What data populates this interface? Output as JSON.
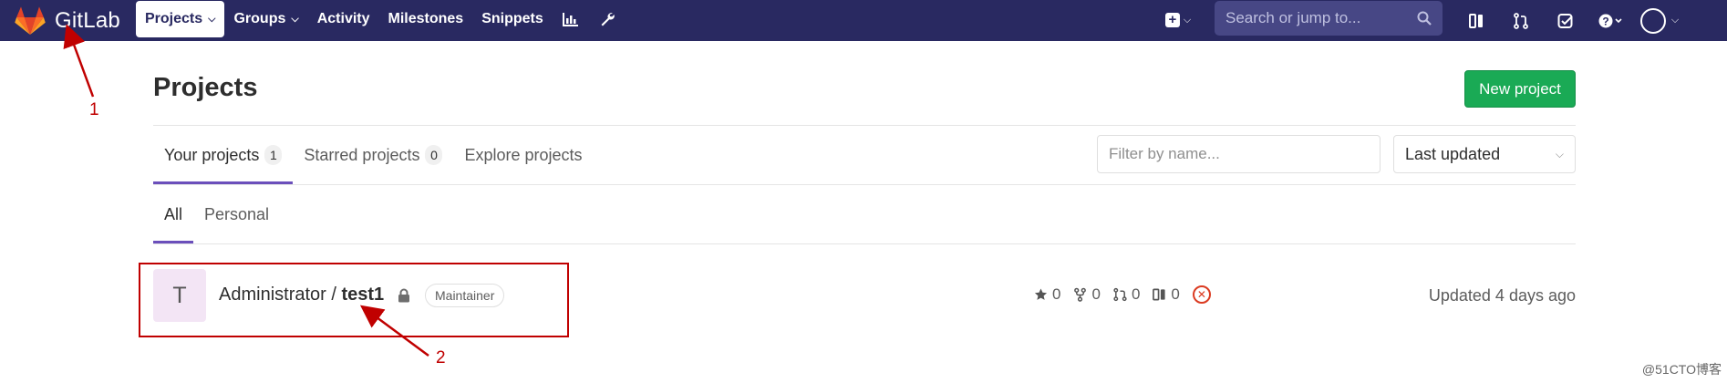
{
  "navbar": {
    "brand": "GitLab",
    "links": [
      {
        "label": "Projects",
        "dropdown": true,
        "active": true
      },
      {
        "label": "Groups",
        "dropdown": true,
        "active": false
      },
      {
        "label": "Activity",
        "dropdown": false,
        "active": false
      },
      {
        "label": "Milestones",
        "dropdown": false,
        "active": false
      },
      {
        "label": "Snippets",
        "dropdown": false,
        "active": false
      }
    ],
    "icons": [
      "chart-icon",
      "wrench-icon"
    ],
    "search_placeholder": "Search or jump to...",
    "right_icons": [
      "todo-sidebar-icon",
      "merge-request-icon",
      "checkbox-icon",
      "help-icon"
    ]
  },
  "page": {
    "title": "Projects",
    "new_project_label": "New project",
    "tabs": [
      {
        "label": "Your projects",
        "count": "1",
        "active": true
      },
      {
        "label": "Starred projects",
        "count": "0",
        "active": false
      },
      {
        "label": "Explore projects",
        "active": false
      }
    ],
    "filter_placeholder": "Filter by name...",
    "sort_value": "Last updated",
    "subtabs": [
      {
        "label": "All",
        "active": true
      },
      {
        "label": "Personal",
        "active": false
      }
    ]
  },
  "project": {
    "avatar_letter": "T",
    "namespace": "Administrator / ",
    "name": "test1",
    "role": "Maintainer",
    "stars": "0",
    "forks": "0",
    "merge_requests": "0",
    "issues": "0",
    "pipeline_status": "failed",
    "updated": "Updated 4 days ago"
  },
  "annotations": {
    "label_1": "1",
    "label_2": "2",
    "color": "#c00000"
  },
  "watermark": "@51CTO博客"
}
